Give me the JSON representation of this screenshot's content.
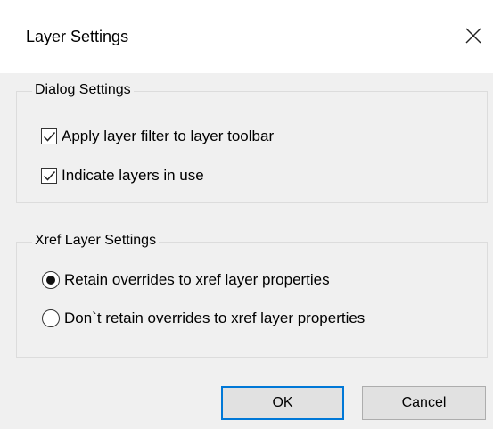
{
  "dialog": {
    "title": "Layer Settings",
    "close_glyph": "close-icon"
  },
  "dialog_settings": {
    "legend": "Dialog Settings",
    "options": [
      {
        "label": "Apply layer filter to layer toolbar",
        "checked": true
      },
      {
        "label": "Indicate layers in use",
        "checked": true
      }
    ]
  },
  "xref_settings": {
    "legend": "Xref Layer Settings",
    "options": [
      {
        "label": "Retain overrides to xref layer properties",
        "selected": true
      },
      {
        "label": "Don`t retain overrides to xref layer properties",
        "selected": false
      }
    ]
  },
  "buttons": {
    "ok": "OK",
    "cancel": "Cancel"
  },
  "colors": {
    "accent": "#0078d7",
    "background": "#f0f0f0"
  }
}
